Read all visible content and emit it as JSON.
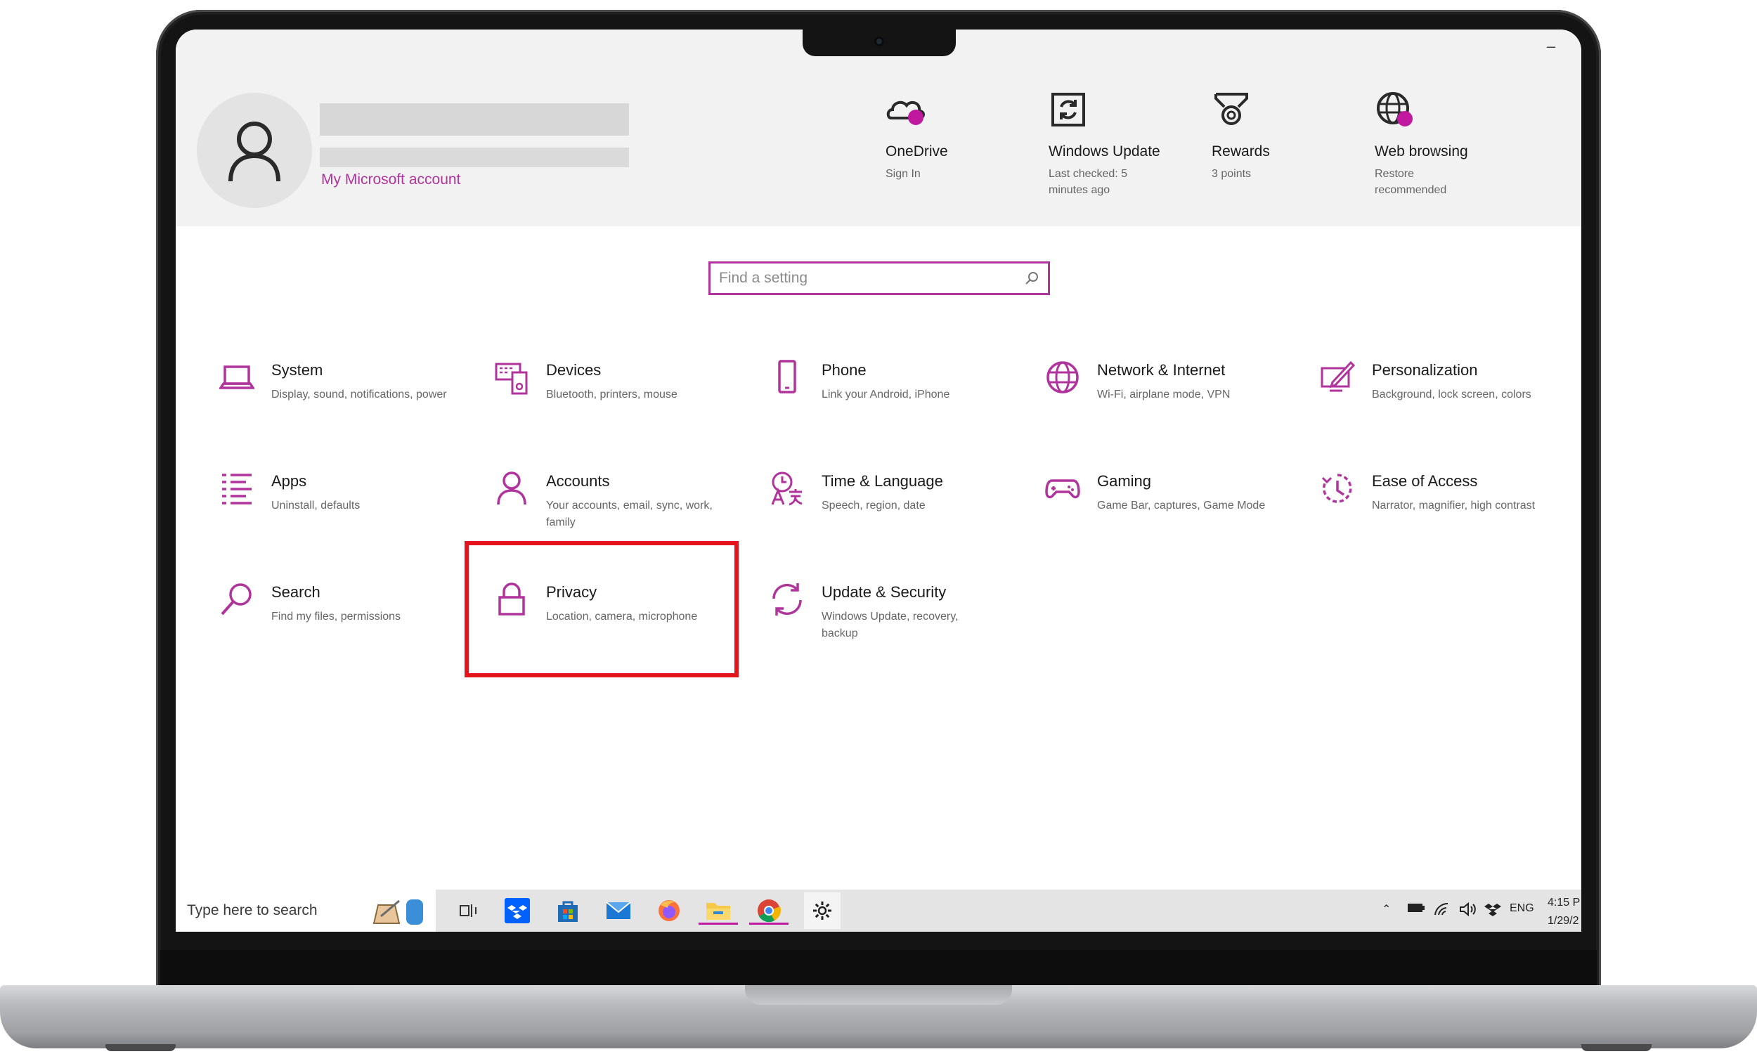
{
  "account": {
    "link_label": "My Microsoft account"
  },
  "quick_items": [
    {
      "title": "OneDrive",
      "subtitle": "Sign In",
      "icon": "onedrive-icon"
    },
    {
      "title": "Windows Update",
      "subtitle": "Last checked: 5 minutes ago",
      "icon": "windows-update-icon"
    },
    {
      "title": "Rewards",
      "subtitle": "3 points",
      "icon": "rewards-icon"
    },
    {
      "title": "Web browsing",
      "subtitle": "Restore recommended",
      "icon": "web-browsing-icon"
    }
  ],
  "search": {
    "placeholder": "Find a setting"
  },
  "categories": [
    {
      "title": "System",
      "desc": "Display, sound, notifications, power",
      "icon": "laptop-icon"
    },
    {
      "title": "Devices",
      "desc": "Bluetooth, printers, mouse",
      "icon": "devices-icon"
    },
    {
      "title": "Phone",
      "desc": "Link your Android, iPhone",
      "icon": "phone-icon"
    },
    {
      "title": "Network & Internet",
      "desc": "Wi-Fi, airplane mode, VPN",
      "icon": "globe-icon"
    },
    {
      "title": "Personalization",
      "desc": "Background, lock screen, colors",
      "icon": "personalization-icon"
    },
    {
      "title": "Apps",
      "desc": "Uninstall, defaults",
      "icon": "apps-list-icon"
    },
    {
      "title": "Accounts",
      "desc": "Your accounts, email, sync, work, family",
      "icon": "person-icon"
    },
    {
      "title": "Time & Language",
      "desc": "Speech, region, date",
      "icon": "time-language-icon"
    },
    {
      "title": "Gaming",
      "desc": "Game Bar, captures, Game Mode",
      "icon": "gamepad-icon"
    },
    {
      "title": "Ease of Access",
      "desc": "Narrator, magnifier, high contrast",
      "icon": "ease-of-access-icon"
    },
    {
      "title": "Search",
      "desc": "Find my files, permissions",
      "icon": "magnifier-icon"
    },
    {
      "title": "Privacy",
      "desc": "Location, camera, microphone",
      "icon": "lock-icon"
    },
    {
      "title": "Update & Security",
      "desc": "Windows Update, recovery, backup",
      "icon": "sync-icon"
    }
  ],
  "highlighted_category": "Privacy",
  "taskbar": {
    "search_placeholder": "Type here to search",
    "apps": [
      "task-view-icon",
      "dropbox-icon",
      "store-icon",
      "mail-icon",
      "firefox-icon",
      "file-explorer-icon",
      "chrome-icon",
      "settings-gear-icon"
    ],
    "language": "ENG",
    "time": "4:15 P",
    "date": "1/29/2"
  },
  "colors": {
    "accent": "#b0349c",
    "highlight_box": "#e3141c",
    "header_bg": "#f2f2f2",
    "taskbar_bg": "#e4e4e4"
  }
}
